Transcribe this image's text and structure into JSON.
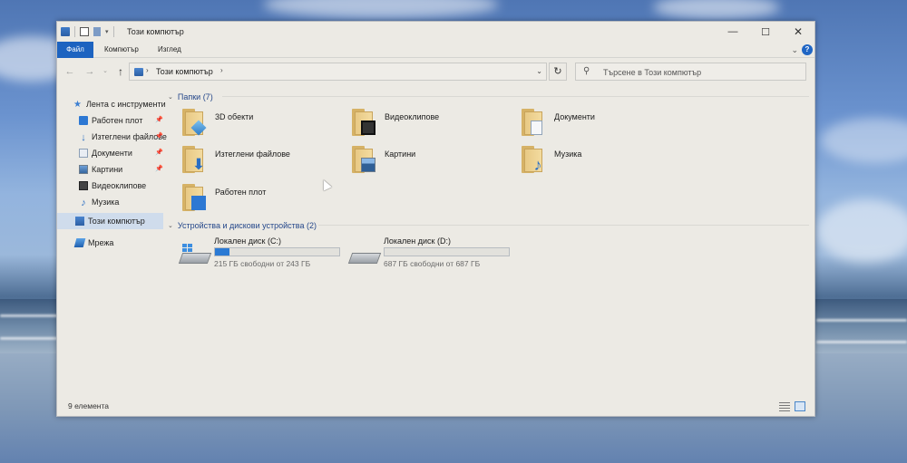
{
  "window": {
    "title": "Този компютър",
    "controls": {
      "minimize": "—",
      "maximize": "☐",
      "close": "✕"
    }
  },
  "ribbon": {
    "tabs": [
      {
        "label": "Файл",
        "active": true
      },
      {
        "label": "Компютър",
        "active": false
      },
      {
        "label": "Изглед",
        "active": false
      }
    ],
    "help": "?"
  },
  "navigation": {
    "address": "Този компютър",
    "search_placeholder": "Търсене в Този компютър",
    "icons": {
      "back": "arrow-left-icon",
      "forward": "arrow-right-icon",
      "up": "arrow-up-icon",
      "refresh": "refresh-icon",
      "search": "search-icon"
    }
  },
  "sidebar": {
    "items": [
      {
        "label": "Лента с инструменти",
        "icon": "star-icon",
        "pinned": false
      },
      {
        "label": "Работен плот",
        "icon": "desktop-icon",
        "pinned": true
      },
      {
        "label": "Изтеглени файлове",
        "icon": "download-icon",
        "pinned": true
      },
      {
        "label": "Документи",
        "icon": "documents-icon",
        "pinned": true
      },
      {
        "label": "Картини",
        "icon": "pictures-icon",
        "pinned": true
      },
      {
        "label": "Видеоклипове",
        "icon": "videos-icon",
        "pinned": false
      },
      {
        "label": "Музика",
        "icon": "music-icon",
        "pinned": false
      },
      {
        "label": "Този компютър",
        "icon": "computer-icon",
        "pinned": false,
        "selected": true
      },
      {
        "label": "Мрежа",
        "icon": "network-icon",
        "pinned": false
      }
    ]
  },
  "folders_group": {
    "title": "Папки (7)",
    "items": [
      {
        "label": "3D обекти",
        "icon": "3d-objects-folder-icon"
      },
      {
        "label": "Видеоклипове",
        "icon": "videos-folder-icon"
      },
      {
        "label": "Документи",
        "icon": "documents-folder-icon"
      },
      {
        "label": "Изтеглени файлове",
        "icon": "downloads-folder-icon"
      },
      {
        "label": "Картини",
        "icon": "pictures-folder-icon"
      },
      {
        "label": "Музика",
        "icon": "music-folder-icon"
      },
      {
        "label": "Работен плот",
        "icon": "desktop-folder-icon"
      }
    ]
  },
  "devices_group": {
    "title": "Устройства и дискови устройства (2)",
    "drives": [
      {
        "label": "Локален диск (C:)",
        "free_text": "215 ГБ свободни от 243 ГБ",
        "used_fraction": 0.115
      },
      {
        "label": "Локален диск (D:)",
        "free_text": "687 ГБ свободни от 687 ГБ",
        "used_fraction": 0.0
      }
    ]
  },
  "status": {
    "count": "9 елемента"
  },
  "colors": {
    "accent": "#1d63c0",
    "selection": "#cfdcec",
    "drive_fill": "#2b7ad4",
    "group_header": "#24478a"
  }
}
